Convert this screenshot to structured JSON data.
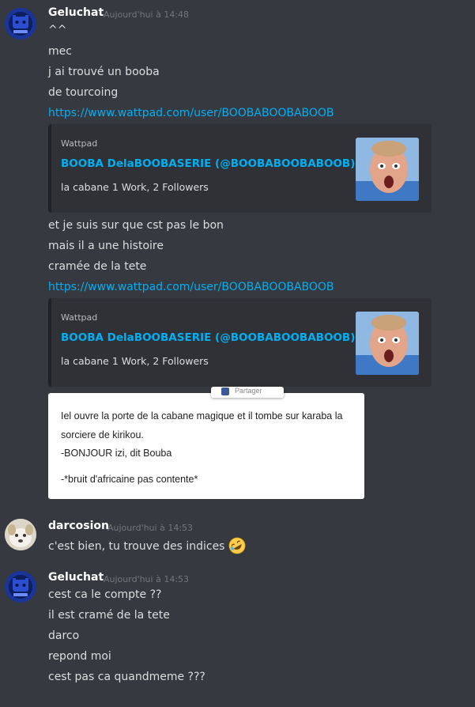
{
  "messages": [
    {
      "username": "Geluchat",
      "timestamp": "Aujourd'hui à 14:48",
      "lines": [
        "^^",
        "mec",
        "j ai trouvé un booba",
        "de tourcoing"
      ],
      "link1": "https://www.wattpad.com/user/BOOBABOOBABOOB",
      "embed1": {
        "provider": "Wattpad",
        "title": "BOOBA DelaBOOBASERIE (@BOOBABOOBABOOB)",
        "description": "la cabane 1 Work, 2 Followers"
      },
      "lines2": [
        "et je suis sur que cst pas le bon",
        "mais il a une histoire",
        "cramée de la tete"
      ],
      "link2": "https://www.wattpad.com/user/BOOBABOOBABOOB",
      "embed2": {
        "provider": "Wattpad",
        "title": "BOOBA DelaBOOBASERIE (@BOOBABOOBABOOB)",
        "description": "la cabane 1 Work, 2 Followers"
      },
      "attachment": {
        "share_label": "Partager",
        "lines": [
          "Iel ouvre la porte de la cabane magique et il tombe sur karaba la",
          "sorciere de kirikou.",
          "-BONJOUR izi, dit Bouba",
          "-*bruit d'africaine pas contente*"
        ]
      }
    },
    {
      "username": "darcosion",
      "timestamp": "Aujourd'hui à 14:53",
      "lines": [
        "c'est bien, tu trouve des indices"
      ],
      "emoji": "rofl-emoji"
    },
    {
      "username": "Geluchat",
      "timestamp": "Aujourd'hui à 14:53",
      "lines": [
        "cest ca le compte ??",
        "il est cramé de la tete",
        "darco",
        "repond moi",
        "cest pas ca quandmeme ???"
      ]
    }
  ],
  "colors": {
    "background": "#36393f",
    "embed_background": "#2f3136",
    "link": "#00b0f4",
    "username": "#ffffff",
    "timestamp": "#72767d",
    "text": "#dcddde"
  }
}
